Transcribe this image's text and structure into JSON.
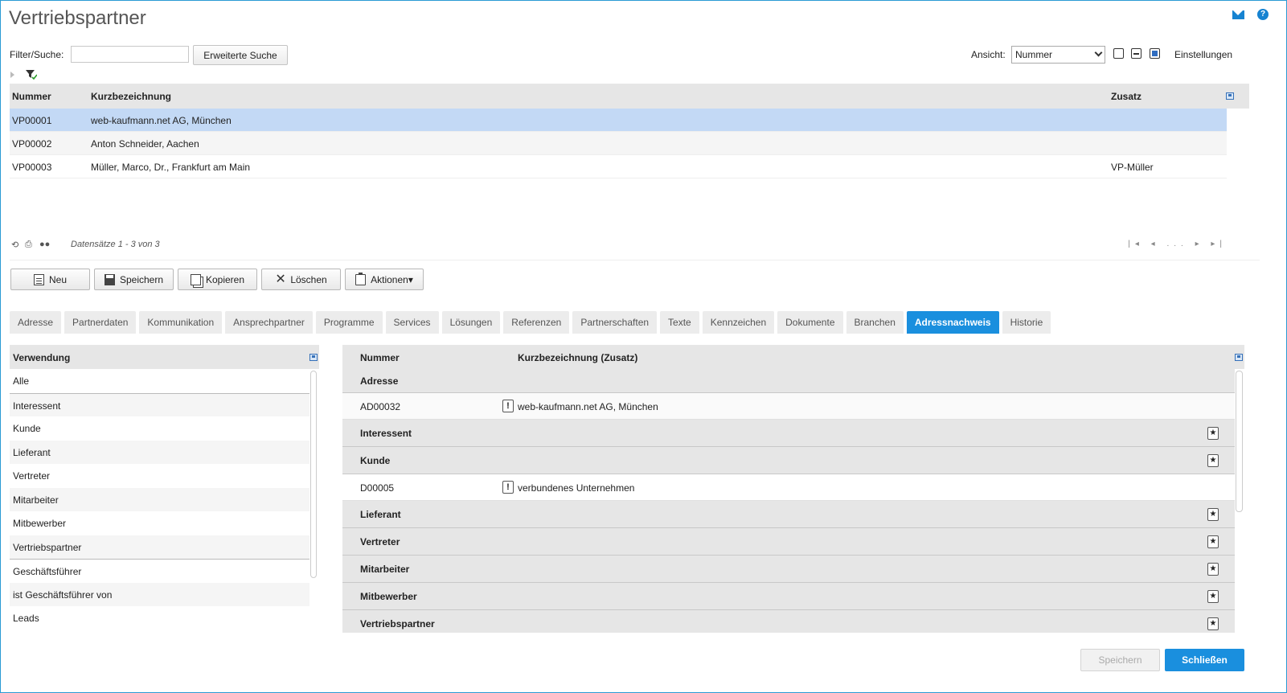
{
  "header": {
    "title": "Vertriebspartner"
  },
  "filter": {
    "label": "Filter/Suche:",
    "value": "",
    "extended_search_label": "Erweiterte Suche",
    "view_label": "Ansicht:",
    "view_selected": "Nummer",
    "settings_label": "Einstellungen"
  },
  "grid": {
    "columns": [
      "Nummer",
      "Kurzbezeichnung",
      "Zusatz"
    ],
    "rows": [
      {
        "nummer": "VP00001",
        "kurz": "web-kaufmann.net AG, München",
        "zusatz": ""
      },
      {
        "nummer": "VP00002",
        "kurz": "Anton Schneider, Aachen",
        "zusatz": ""
      },
      {
        "nummer": "VP00003",
        "kurz": "Müller, Marco, Dr., Frankfurt am Main",
        "zusatz": "VP-Müller"
      }
    ],
    "records_text": "Datensätze 1 - 3 von 3",
    "pager_text": "|◂ ◂ ... ▸ ▸|"
  },
  "toolbar": {
    "new_label": "Neu",
    "save_label": "Speichern",
    "copy_label": "Kopieren",
    "delete_label": "Löschen",
    "actions_label": "Aktionen▾"
  },
  "tabs": [
    "Adresse",
    "Partnerdaten",
    "Kommunikation",
    "Ansprechpartner",
    "Programme",
    "Services",
    "Lösungen",
    "Referenzen",
    "Partnerschaften",
    "Texte",
    "Kennzeichen",
    "Dokumente",
    "Branchen",
    "Adressnachweis",
    "Historie"
  ],
  "active_tab": "Adressnachweis",
  "usage": {
    "header": "Verwendung",
    "items": [
      "Alle",
      "Interessent",
      "Kunde",
      "Lieferant",
      "Vertreter",
      "Mitarbeiter",
      "Mitbewerber",
      "Vertriebspartner",
      "Geschäftsführer",
      "ist Geschäftsführer von",
      "Leads"
    ]
  },
  "proof": {
    "col_nummer": "Nummer",
    "col_kurz": "Kurzbezeichnung (Zusatz)",
    "address_group": "Adresse",
    "address_row": {
      "nummer": "AD00032",
      "text": "web-kaufmann.net AG, München"
    },
    "interessent": "Interessent",
    "kunde": "Kunde",
    "kunde_row": {
      "nummer": "D00005",
      "text": "verbundenes Unternehmen"
    },
    "lieferant": "Lieferant",
    "vertreter": "Vertreter",
    "mitarbeiter": "Mitarbeiter",
    "mitbewerber": "Mitbewerber",
    "vertriebspartner": "Vertriebspartner"
  },
  "footer": {
    "save_label": "Speichern",
    "close_label": "Schließen"
  },
  "colors": {
    "accent": "#1a8fde",
    "selected_row": "#c3d9f5"
  }
}
